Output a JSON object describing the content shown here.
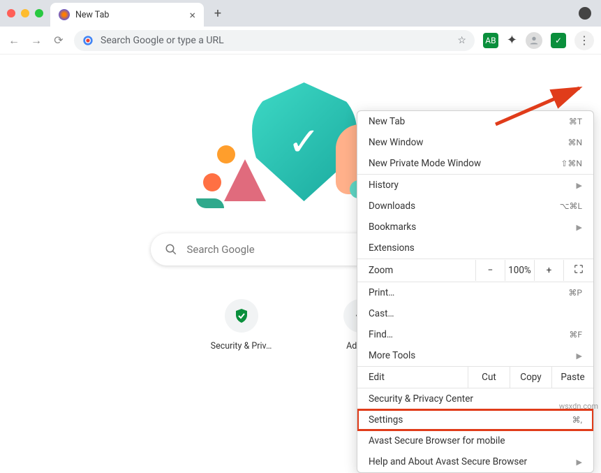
{
  "tab": {
    "title": "New Tab"
  },
  "omnibox": {
    "placeholder": "Search Google or type a URL"
  },
  "search": {
    "placeholder": "Search Google"
  },
  "shortcuts": [
    {
      "label": "Security & Priv…"
    },
    {
      "label": "Add sh"
    }
  ],
  "menu": {
    "new_tab": "New Tab",
    "new_tab_kbd": "⌘T",
    "new_window": "New Window",
    "new_window_kbd": "⌘N",
    "new_private": "New Private Mode Window",
    "new_private_kbd": "⇧⌘N",
    "history": "History",
    "downloads": "Downloads",
    "downloads_kbd": "⌥⌘L",
    "bookmarks": "Bookmarks",
    "extensions": "Extensions",
    "zoom": "Zoom",
    "zoom_value": "100%",
    "print": "Print…",
    "print_kbd": "⌘P",
    "cast": "Cast…",
    "find": "Find…",
    "find_kbd": "⌘F",
    "more_tools": "More Tools",
    "edit": "Edit",
    "cut": "Cut",
    "copy": "Copy",
    "paste": "Paste",
    "security_center": "Security & Privacy Center",
    "settings": "Settings",
    "settings_kbd": "⌘,",
    "mobile": "Avast Secure Browser for mobile",
    "help": "Help and About Avast Secure Browser"
  },
  "watermark": "wsxdn.com"
}
